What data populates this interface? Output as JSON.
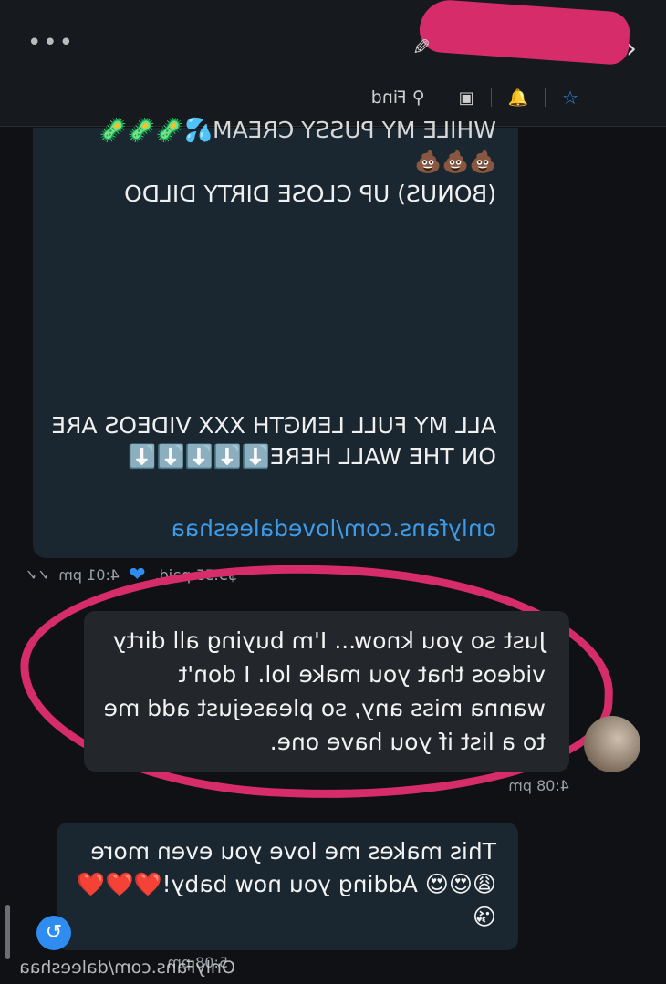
{
  "header": {
    "back_icon": "chevron-left-icon",
    "name": "",
    "edit_icon": "pencil-icon",
    "more_icon": "more-horizontal-icon",
    "find_label": "Find",
    "icons": [
      "star-icon",
      "bell-icon",
      "image-icon",
      "search-icon"
    ]
  },
  "messages": [
    {
      "direction": "incoming",
      "lines": {
        "cut": "WHILE MY PUSSY CREAM💦🦠🦠🦠",
        "poop": "💩💩💩",
        "bonus": "(BONUS) UP CLOSE DIRTY DILDO",
        "all": "ALL MY FULL LENGTH XXX VIDEOS ARE ON THE WALL HERE⬇️⬇️⬇️⬇️⬇️",
        "link": "onlyfans.com/lovedaleeshaa"
      },
      "paid": "$5.55 paid,",
      "time": "4:01 pm"
    },
    {
      "direction": "outgoing",
      "text": "Just so you know... I'm buying all dirty videos that you make lol. I don't wanna miss any, so pleasejust add me to a list if you have one.",
      "time": "4:08 pm"
    },
    {
      "direction": "incoming",
      "text": "This makes me love you even more 😩😍😍 Adding you now baby!❤️❤️❤️😘",
      "time": "5:08 pm"
    }
  ],
  "watermark": "OnlyFans.com/daleeshaa",
  "colors": {
    "accent": "#2f8cf0",
    "marker": "#d62d6a",
    "incoming_bg": "#1a2630",
    "outgoing_bg": "#23272c"
  }
}
